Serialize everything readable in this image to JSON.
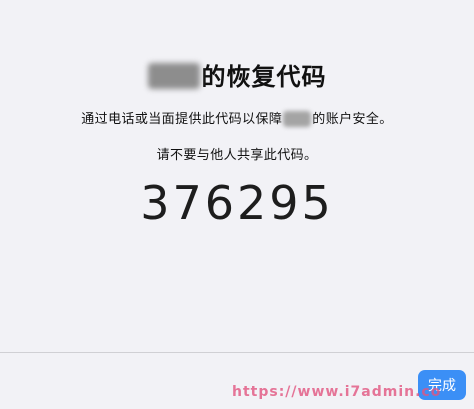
{
  "title_suffix": "的恢复代码",
  "description": {
    "before": "通过电话或当面提供此代码以保障",
    "after": "的账户安全。"
  },
  "warning": "请不要与他人共享此代码。",
  "recovery_code": "376295",
  "done_label": "完成",
  "watermark": "https://www.i7admin.co"
}
